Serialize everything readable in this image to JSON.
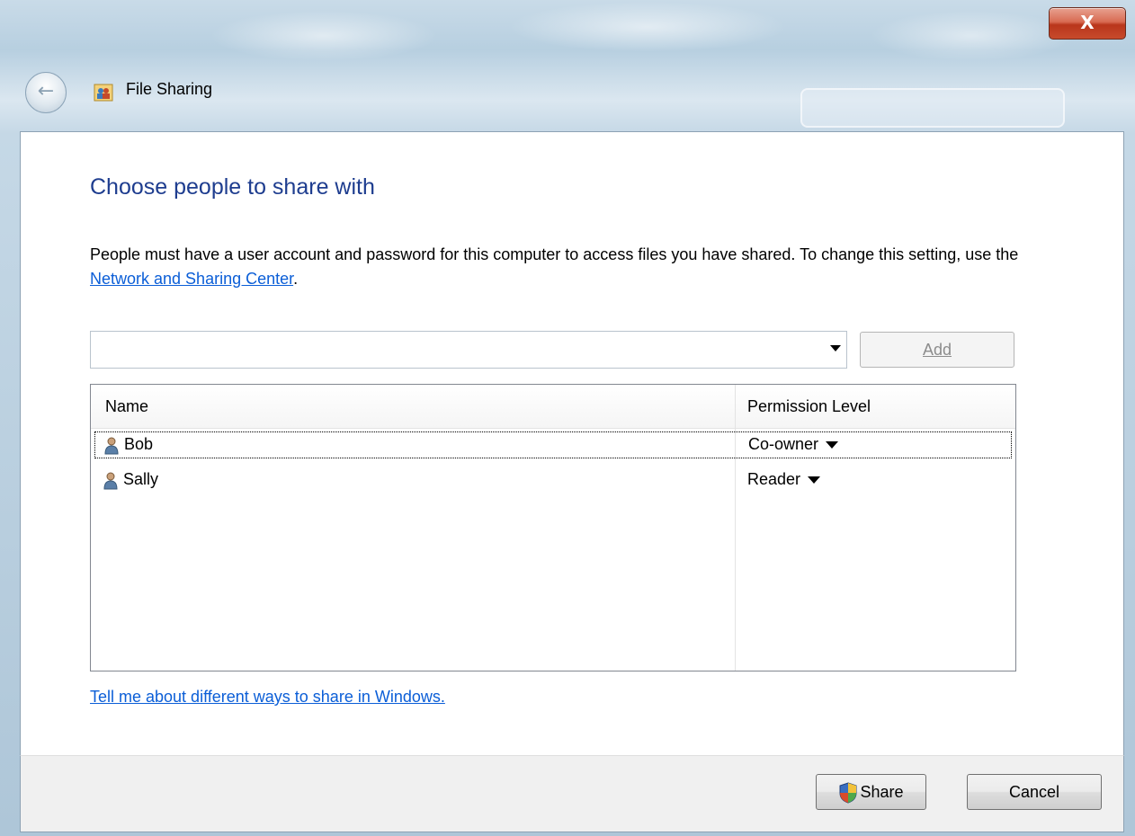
{
  "window": {
    "title": "File Sharing",
    "close_label": "X"
  },
  "main": {
    "heading": "Choose people to share with",
    "description_text": "People must have a user account and password for this computer to access files you have shared.  To change this setting, use the ",
    "description_link": "Network and Sharing Center",
    "description_end": ".",
    "combo_value": "",
    "add_button": "Add",
    "help_link": "Tell me about different ways to share in Windows."
  },
  "list": {
    "columns": [
      "Name",
      "Permission Level"
    ],
    "rows": [
      {
        "name": "Bob",
        "permission": "Co-owner"
      },
      {
        "name": "Sally",
        "permission": "Reader"
      }
    ]
  },
  "footer": {
    "share_button": "Share",
    "cancel_button": "Cancel"
  },
  "colors": {
    "heading": "#1e3d8f",
    "link": "#0b5ed7"
  },
  "icons": [
    "back-arrow-icon",
    "file-sharing-icon",
    "user-icon",
    "shield-icon",
    "dropdown-arrow-icon"
  ]
}
